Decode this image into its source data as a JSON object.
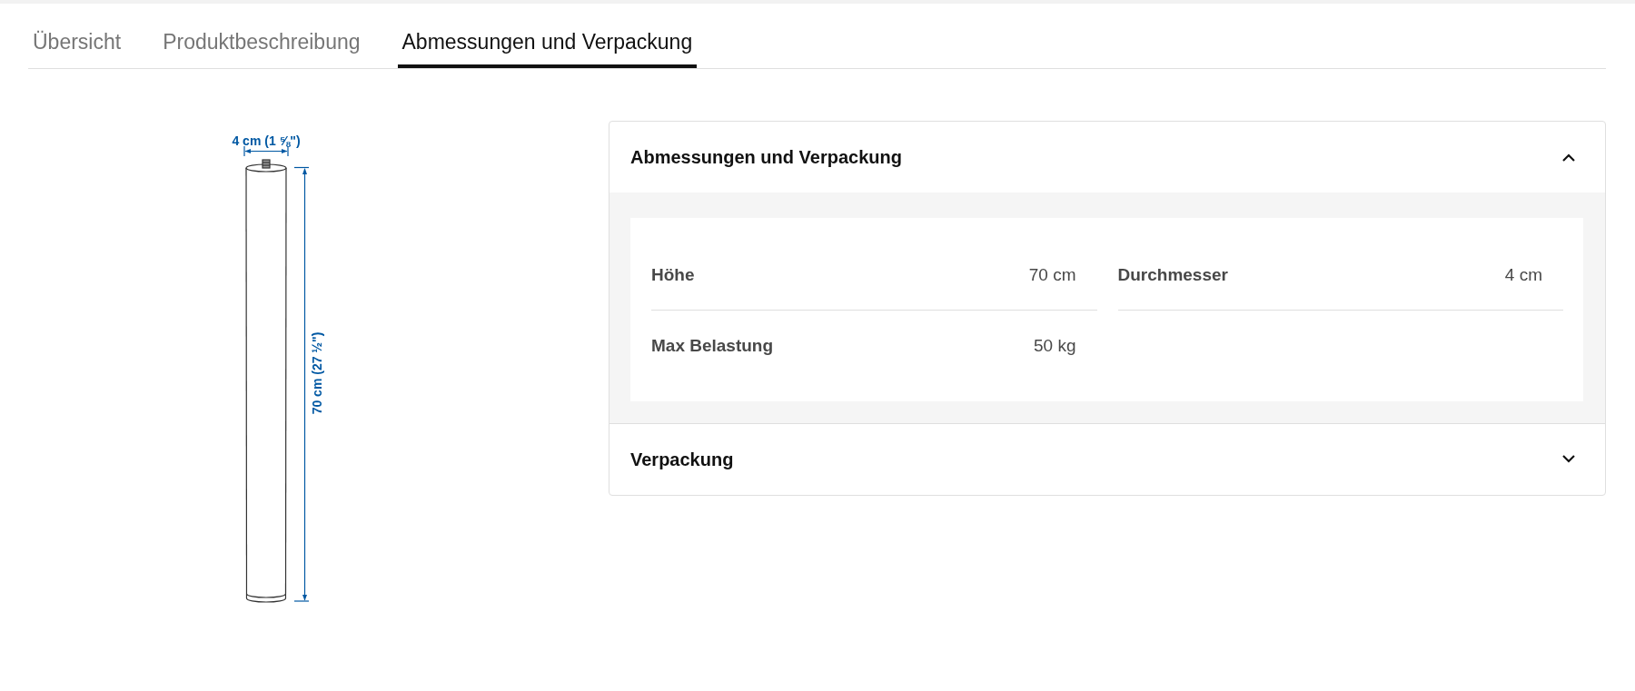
{
  "tabs": [
    {
      "label": "Übersicht",
      "selected": false
    },
    {
      "label": "Produktbeschreibung",
      "selected": false
    },
    {
      "label": "Abmessungen und Verpackung",
      "selected": true
    }
  ],
  "illustration": {
    "width_label": "4 cm (1 ⅝\")",
    "height_label": "70 cm (27 ½\")"
  },
  "sections": [
    {
      "title": "Abmessungen und Verpackung",
      "expanded": true,
      "specs": [
        {
          "label": "Höhe",
          "value": "70 cm"
        },
        {
          "label": "Durchmesser",
          "value": "4 cm"
        },
        {
          "label": "Max Belastung",
          "value": "50 kg"
        }
      ]
    },
    {
      "title": "Verpackung",
      "expanded": false
    }
  ]
}
